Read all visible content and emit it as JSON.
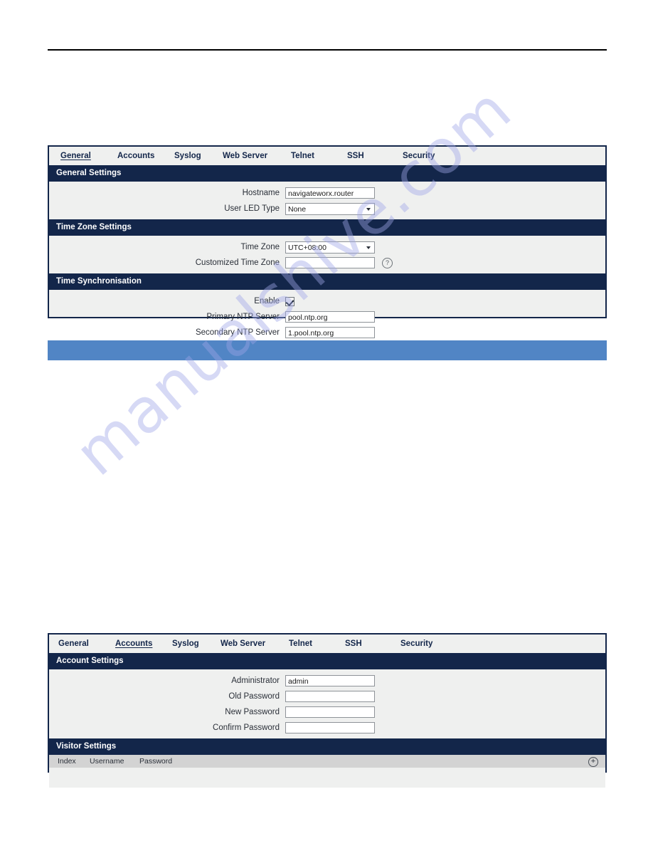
{
  "page": {
    "watermark": "manualshive.com"
  },
  "tabs": [
    "General",
    "Accounts",
    "Syslog",
    "Web Server",
    "Telnet",
    "SSH",
    "Security"
  ],
  "panel_general": {
    "active_tab": "General",
    "sections": {
      "general_settings": {
        "title": "General Settings",
        "fields": {
          "hostname": {
            "label": "Hostname",
            "value": "navigateworx.router"
          },
          "user_led_type": {
            "label": "User LED Type",
            "value": "None"
          }
        }
      },
      "time_zone_settings": {
        "title": "Time Zone Settings",
        "fields": {
          "time_zone": {
            "label": "Time Zone",
            "value": "UTC+08:00"
          },
          "customized_time_zone": {
            "label": "Customized Time Zone",
            "value": ""
          }
        }
      },
      "time_synchronisation": {
        "title": "Time Synchronisation",
        "fields": {
          "enable": {
            "label": "Enable",
            "checked": true
          },
          "primary_ntp": {
            "label": "Primary NTP Server",
            "value": "pool.ntp.org"
          },
          "secondary_ntp": {
            "label": "Secondary NTP Server",
            "value": "1.pool.ntp.org"
          }
        }
      }
    }
  },
  "panel_accounts": {
    "active_tab": "Accounts",
    "sections": {
      "account_settings": {
        "title": "Account Settings",
        "fields": {
          "administrator": {
            "label": "Administrator",
            "value": "admin"
          },
          "old_password": {
            "label": "Old Password",
            "value": ""
          },
          "new_password": {
            "label": "New Password",
            "value": ""
          },
          "confirm_password": {
            "label": "Confirm Password",
            "value": ""
          }
        }
      },
      "visitor_settings": {
        "title": "Visitor Settings",
        "columns": [
          "Index",
          "Username",
          "Password"
        ],
        "rows": [],
        "add_icon": "plus-circle-icon"
      }
    }
  },
  "icons": {
    "help": "?",
    "add": "+"
  },
  "colors": {
    "header_navy": "#13264a",
    "panel_bg": "#eff0ef",
    "accent_blue": "#5185c5",
    "table_head_gray": "#d3d3d3"
  }
}
